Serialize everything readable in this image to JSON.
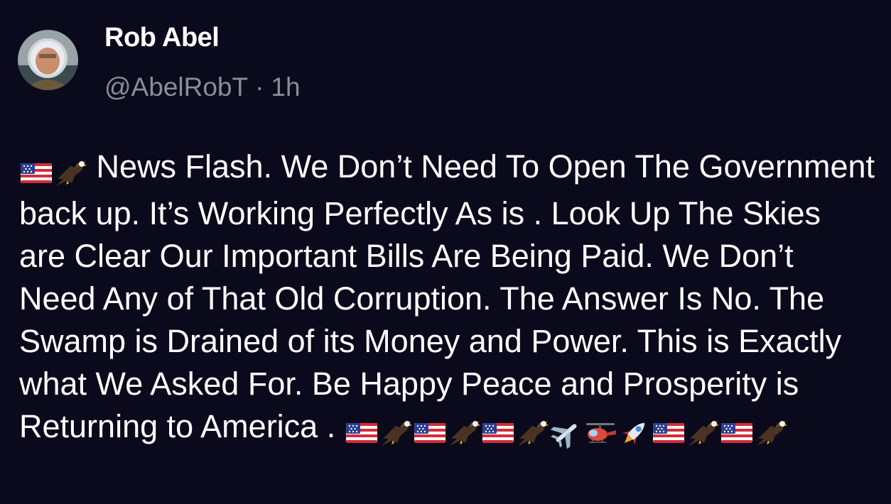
{
  "post": {
    "author": {
      "name": "Rob Abel",
      "handle": "@AbelRobT",
      "separator": "·",
      "time": "1h"
    },
    "lead_emojis": [
      "us-flag-emoji",
      "eagle-emoji"
    ],
    "text": "News Flash. We Don’t Need To Open The Government back up. It’s Working Perfectly As is . Look Up The Skies are Clear Our Important Bills Are Being Paid. We Don’t Need Any of That Old Corruption. The Answer Is No. The Swamp is Drained of its Money and Power. This is Exactly what We Asked For. Be Happy Peace and Prosperity is Returning to America .",
    "trail_emojis": [
      "us-flag-emoji",
      "eagle-emoji",
      "us-flag-emoji",
      "eagle-emoji",
      "us-flag-emoji",
      "eagle-emoji",
      "airplane-emoji",
      "helicopter-emoji",
      "rocket-emoji",
      "us-flag-emoji",
      "eagle-emoji",
      "us-flag-emoji",
      "eagle-emoji"
    ]
  },
  "colors": {
    "background": "#0b0a1c",
    "text": "#ffffff",
    "muted": "#8a8d97"
  }
}
